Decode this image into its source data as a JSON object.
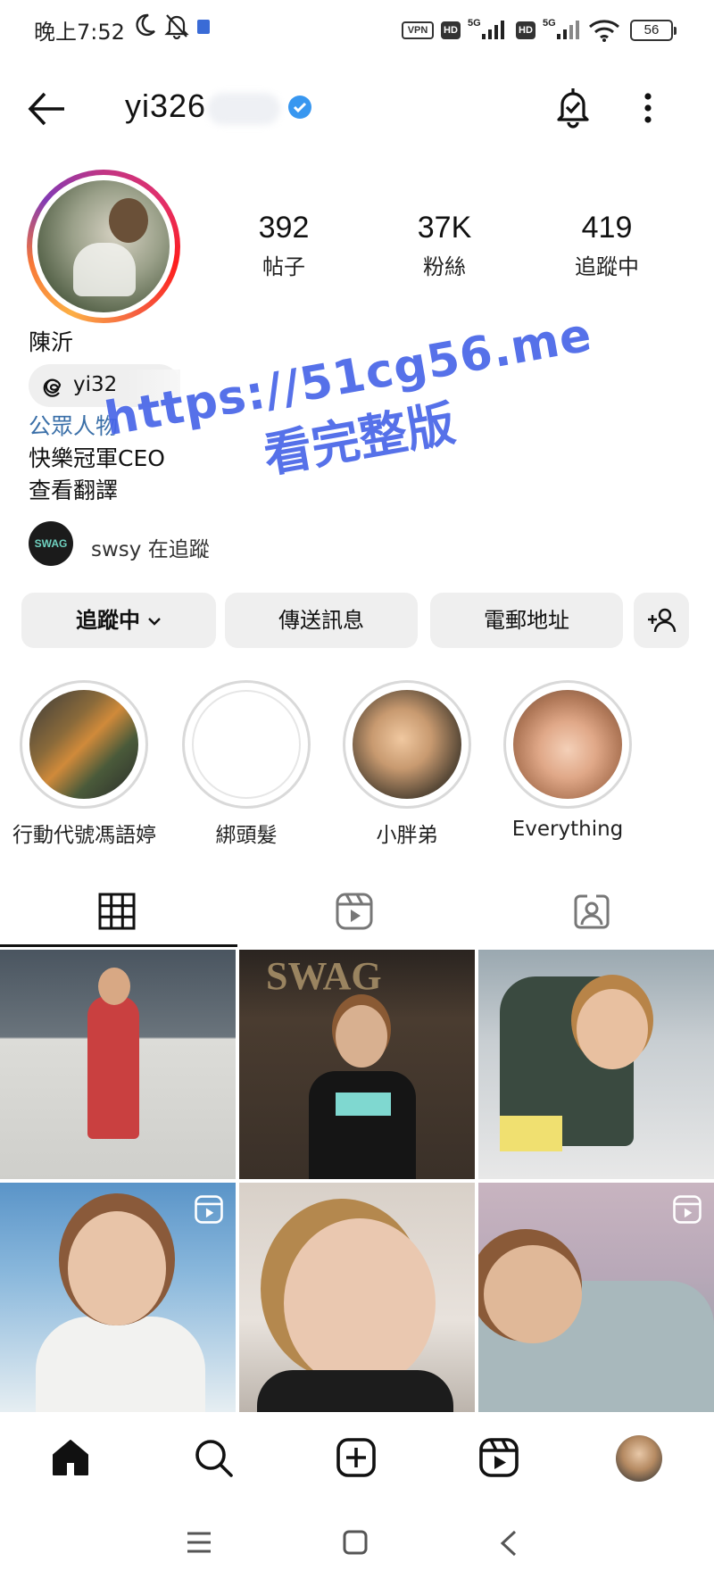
{
  "status_bar": {
    "time": "晚上7:52",
    "vpn": "VPN",
    "hd1": "HD",
    "hd2": "HD",
    "net1": "5G",
    "net2": "5G",
    "battery": "56"
  },
  "header": {
    "username": "yi326",
    "verified": true
  },
  "profile": {
    "stats": [
      {
        "value": "392",
        "label": "帖子"
      },
      {
        "value": "37K",
        "label": "粉絲"
      },
      {
        "value": "419",
        "label": "追蹤中"
      }
    ],
    "display_name": "陳沂",
    "threads_handle": "yi32",
    "category": "公眾人物",
    "bio": [
      "快樂冠軍CEO",
      "查看翻譯"
    ],
    "followed_by_avatar": "SWAG",
    "followed_by_text": "swsy        在追蹤"
  },
  "actions": {
    "following": "追蹤中",
    "message": "傳送訊息",
    "email": "電郵地址"
  },
  "highlights": [
    {
      "label": "行動代號馮語婷"
    },
    {
      "label": "綁頭髮"
    },
    {
      "label": "小胖弟"
    },
    {
      "label": "Everything"
    }
  ],
  "tabs": [
    {
      "icon": "grid-icon",
      "active": true
    },
    {
      "icon": "reels-icon",
      "active": false
    },
    {
      "icon": "tagged-icon",
      "active": false
    }
  ],
  "grid_posts": [
    {
      "kind": "photo",
      "text": ""
    },
    {
      "kind": "photo",
      "text": "SWAG"
    },
    {
      "kind": "photo",
      "text": ""
    },
    {
      "kind": "reel",
      "text": ""
    },
    {
      "kind": "photo",
      "text": ""
    },
    {
      "kind": "reel",
      "text": ""
    }
  ],
  "watermark": {
    "url": "https://51cg56.me",
    "text": "看完整版"
  },
  "colors": {
    "accent_link": "#3a6fa8",
    "verified": "#3897f0",
    "button_bg": "#efefef",
    "watermark": "#4866e8"
  }
}
